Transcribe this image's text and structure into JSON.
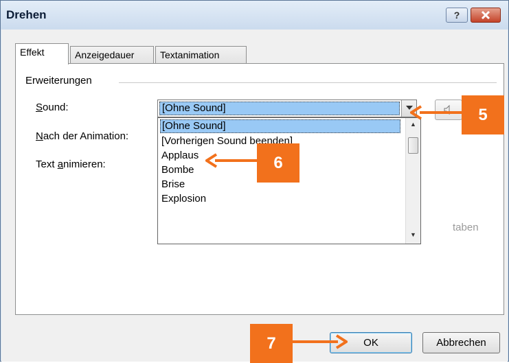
{
  "window": {
    "title": "Drehen",
    "help_label": "?",
    "close_label": "x"
  },
  "tabs": [
    {
      "label": "Effekt",
      "active": true
    },
    {
      "label": "Anzeigedauer",
      "active": false
    },
    {
      "label": "Textanimation",
      "active": false
    }
  ],
  "group": {
    "label": "Erweiterungen"
  },
  "fields": {
    "sound": {
      "label_pre": "",
      "label_u": "S",
      "label_post": "ound:",
      "value": "[Ohne Sound]"
    },
    "after": {
      "label_pre": "",
      "label_u": "N",
      "label_post": "ach der Animation:"
    },
    "text": {
      "label_pre": "Text ",
      "label_u": "a",
      "label_post": "nimieren:"
    }
  },
  "dropdown": {
    "items": [
      "[Ohne Sound]",
      "[Vorherigen Sound beenden]",
      "Applaus",
      "Bombe",
      "Brise",
      "Explosion"
    ],
    "selected_index": 0
  },
  "faded_text": "taben",
  "buttons": {
    "ok": "OK",
    "cancel": "Abbrechen"
  },
  "callouts": {
    "c5": "5",
    "c6": "6",
    "c7": "7"
  },
  "colors": {
    "accent": "#f2711c",
    "selection": "#99c9f5",
    "title_bg": "#d7e4f2"
  },
  "icons": {
    "speaker": "speaker-icon",
    "dropdown": "chevron-down-icon"
  }
}
